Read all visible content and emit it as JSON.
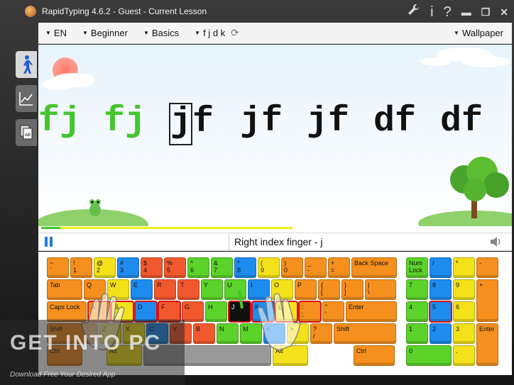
{
  "window": {
    "title": "RapidTyping 4.6.2 - Guest - Current Lesson"
  },
  "titlebar_icons": [
    "wrench-icon",
    "info-icon",
    "help-icon",
    "minimize-icon",
    "maximize-icon",
    "close-icon"
  ],
  "toolbar": {
    "language": "EN",
    "level": "Beginner",
    "course": "Basics",
    "lesson": "f j d k",
    "wallpaper": "Wallpaper"
  },
  "sidebar": [
    "typing-lesson-icon",
    "statistics-icon",
    "lesson-editor-icon"
  ],
  "lesson": {
    "words": [
      {
        "text": "fj",
        "state": "done"
      },
      {
        "text": "fj",
        "state": "done"
      },
      {
        "cursor": "j",
        "rest": "f",
        "state": "current"
      },
      {
        "text": "jf",
        "state": "todo"
      },
      {
        "text": "jf",
        "state": "todo"
      },
      {
        "text": "df",
        "state": "todo"
      },
      {
        "text": "df",
        "state": "todo"
      }
    ],
    "progress_done": 0.04,
    "progress_buffer": 0.53
  },
  "info": {
    "finger_hint": "Right index finger - j"
  },
  "keyboard": {
    "row0": [
      {
        "l": "~\n`",
        "c": "or"
      },
      {
        "l": "!\n1",
        "c": "or"
      },
      {
        "l": "@\n2",
        "c": "yl"
      },
      {
        "l": "#\n3",
        "c": "bl"
      },
      {
        "l": "$\n4",
        "c": "rd"
      },
      {
        "l": "%\n5",
        "c": "rd"
      },
      {
        "l": "^\n6",
        "c": "gr"
      },
      {
        "l": "&\n7",
        "c": "gr"
      },
      {
        "l": "*\n8",
        "c": "bl"
      },
      {
        "l": "(\n9",
        "c": "yl"
      },
      {
        "l": ")\n0",
        "c": "or"
      },
      {
        "l": "_\n-",
        "c": "or"
      },
      {
        "l": "+\n=",
        "c": "or"
      },
      {
        "l": "Back Space",
        "c": "or"
      }
    ],
    "row1": [
      {
        "l": "Tab",
        "c": "or"
      },
      {
        "l": "Q",
        "c": "or"
      },
      {
        "l": "W",
        "c": "yl"
      },
      {
        "l": "E",
        "c": "bl"
      },
      {
        "l": "R",
        "c": "rd"
      },
      {
        "l": "T",
        "c": "rd"
      },
      {
        "l": "Y",
        "c": "gr"
      },
      {
        "l": "U",
        "c": "gr"
      },
      {
        "l": "I",
        "c": "bl"
      },
      {
        "l": "O",
        "c": "yl"
      },
      {
        "l": "P",
        "c": "or"
      },
      {
        "l": "{\n[",
        "c": "or"
      },
      {
        "l": "}\n]",
        "c": "or"
      },
      {
        "l": "|\n\\",
        "c": "or"
      }
    ],
    "row2": [
      {
        "l": "Caps Lock",
        "c": "or"
      },
      {
        "l": "A",
        "c": "or",
        "hl": true
      },
      {
        "l": "S",
        "c": "yl",
        "hl": true
      },
      {
        "l": "D",
        "c": "bl",
        "hl": true
      },
      {
        "l": "F",
        "c": "rd",
        "hl": true
      },
      {
        "l": "G",
        "c": "rd"
      },
      {
        "l": "H",
        "c": "gr"
      },
      {
        "l": "J",
        "c": "dk",
        "hl": true
      },
      {
        "l": "K",
        "c": "bl",
        "hl": true
      },
      {
        "l": "L",
        "c": "yl",
        "hl": true
      },
      {
        "l": ":\n;",
        "c": "or",
        "hl": true
      },
      {
        "l": "\"\n'",
        "c": "or"
      },
      {
        "l": "Enter",
        "c": "or"
      }
    ],
    "row3": [
      {
        "l": "Shift",
        "c": "or"
      },
      {
        "l": "Z",
        "c": "yl"
      },
      {
        "l": "X",
        "c": "yl"
      },
      {
        "l": "C",
        "c": "bl"
      },
      {
        "l": "V",
        "c": "rd"
      },
      {
        "l": "B",
        "c": "rd"
      },
      {
        "l": "N",
        "c": "gr"
      },
      {
        "l": "M",
        "c": "gr"
      },
      {
        "l": "<\n,",
        "c": "bl"
      },
      {
        "l": ">\n.",
        "c": "yl"
      },
      {
        "l": "?\n/",
        "c": "or"
      },
      {
        "l": "Shift",
        "c": "or"
      }
    ],
    "row4": [
      {
        "l": "Ctrl",
        "c": "or"
      },
      {
        "l": "Alt",
        "c": "yl"
      },
      {
        "l": "",
        "c": "gy"
      },
      {
        "l": "Alt",
        "c": "yl"
      },
      {
        "l": "Ctrl",
        "c": "or"
      }
    ],
    "numpad": [
      {
        "l": "Num\nLock",
        "c": "gr"
      },
      {
        "l": "/",
        "c": "bl"
      },
      {
        "l": "*",
        "c": "yl"
      },
      {
        "l": "-",
        "c": "or"
      },
      {
        "l": "7",
        "c": "gr"
      },
      {
        "l": "8",
        "c": "bl"
      },
      {
        "l": "9",
        "c": "yl"
      },
      {
        "l": "+",
        "c": "or"
      },
      {
        "l": "4",
        "c": "gr"
      },
      {
        "l": "5",
        "c": "bl",
        "hl": true
      },
      {
        "l": "6",
        "c": "yl"
      },
      {
        "l": "1",
        "c": "gr"
      },
      {
        "l": "2",
        "c": "bl"
      },
      {
        "l": "3",
        "c": "yl"
      },
      {
        "l": "Enter",
        "c": "or"
      },
      {
        "l": "0",
        "c": "gr"
      },
      {
        "l": ".",
        "c": "yl"
      }
    ]
  },
  "watermark": {
    "big": "GET INTO PC",
    "small": "Download Free Your Desired App"
  }
}
